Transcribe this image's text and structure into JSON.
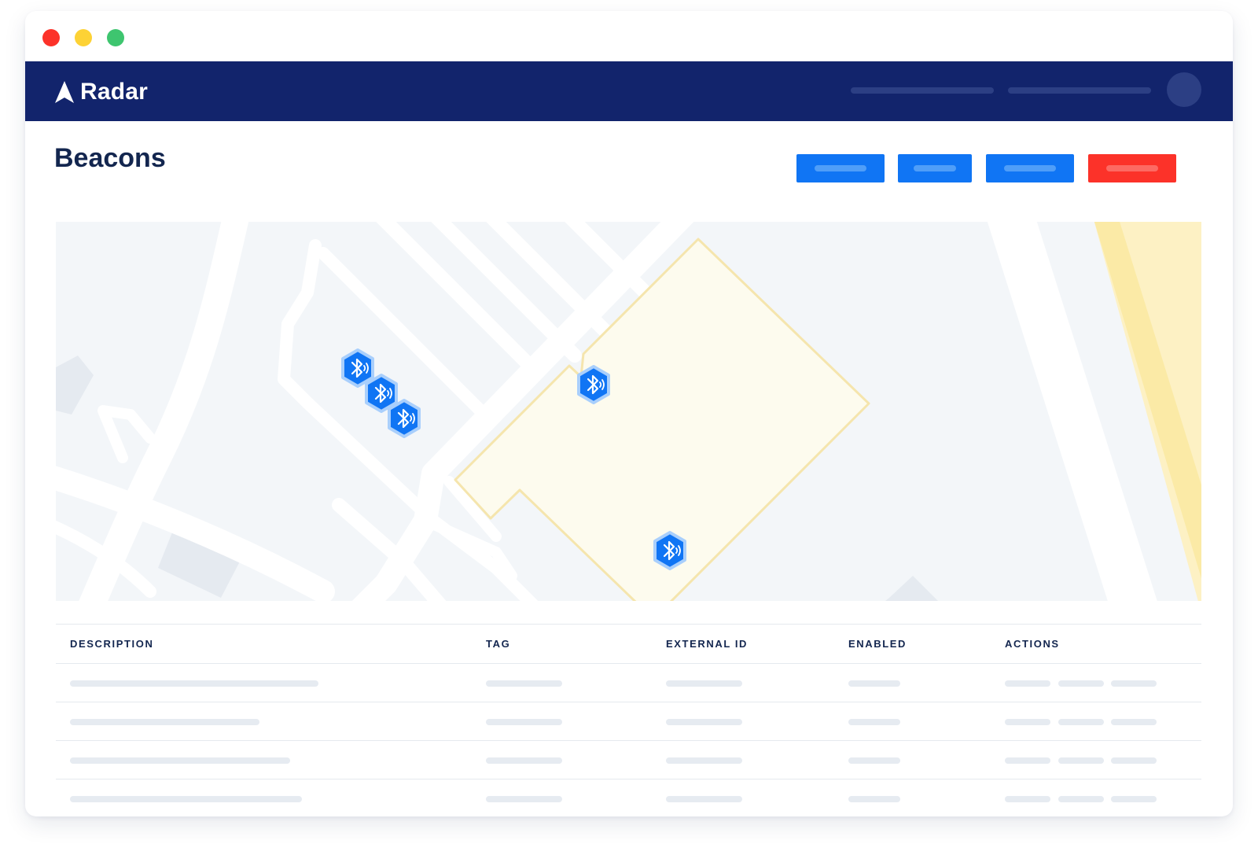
{
  "window": {
    "controls": [
      "close",
      "minimize",
      "maximize"
    ]
  },
  "navbar": {
    "brand": "Radar",
    "logo_icon": "radar-arrow-logo-icon",
    "background": "#12246c"
  },
  "page": {
    "title": "Beacons"
  },
  "toolbar": {
    "buttons": [
      {
        "name": "action-button-1",
        "color": "#1075f4"
      },
      {
        "name": "action-button-2",
        "color": "#1075f4"
      },
      {
        "name": "action-button-3",
        "color": "#1075f4"
      },
      {
        "name": "delete-button",
        "color": "#fc3229"
      }
    ]
  },
  "map": {
    "geofence_fill": "#fdfbee",
    "geofence_stroke": "#f5e5ad",
    "beacon_icon": "bluetooth-icon",
    "beacon_color": "#1075f4",
    "beacon_count": 5
  },
  "table": {
    "columns": [
      "DESCRIPTION",
      "TAG",
      "EXTERNAL ID",
      "ENABLED",
      "ACTIONS"
    ],
    "row_count": 4
  },
  "colors": {
    "accent": "#1075f4",
    "danger": "#fc3229",
    "text": "#13264f"
  }
}
